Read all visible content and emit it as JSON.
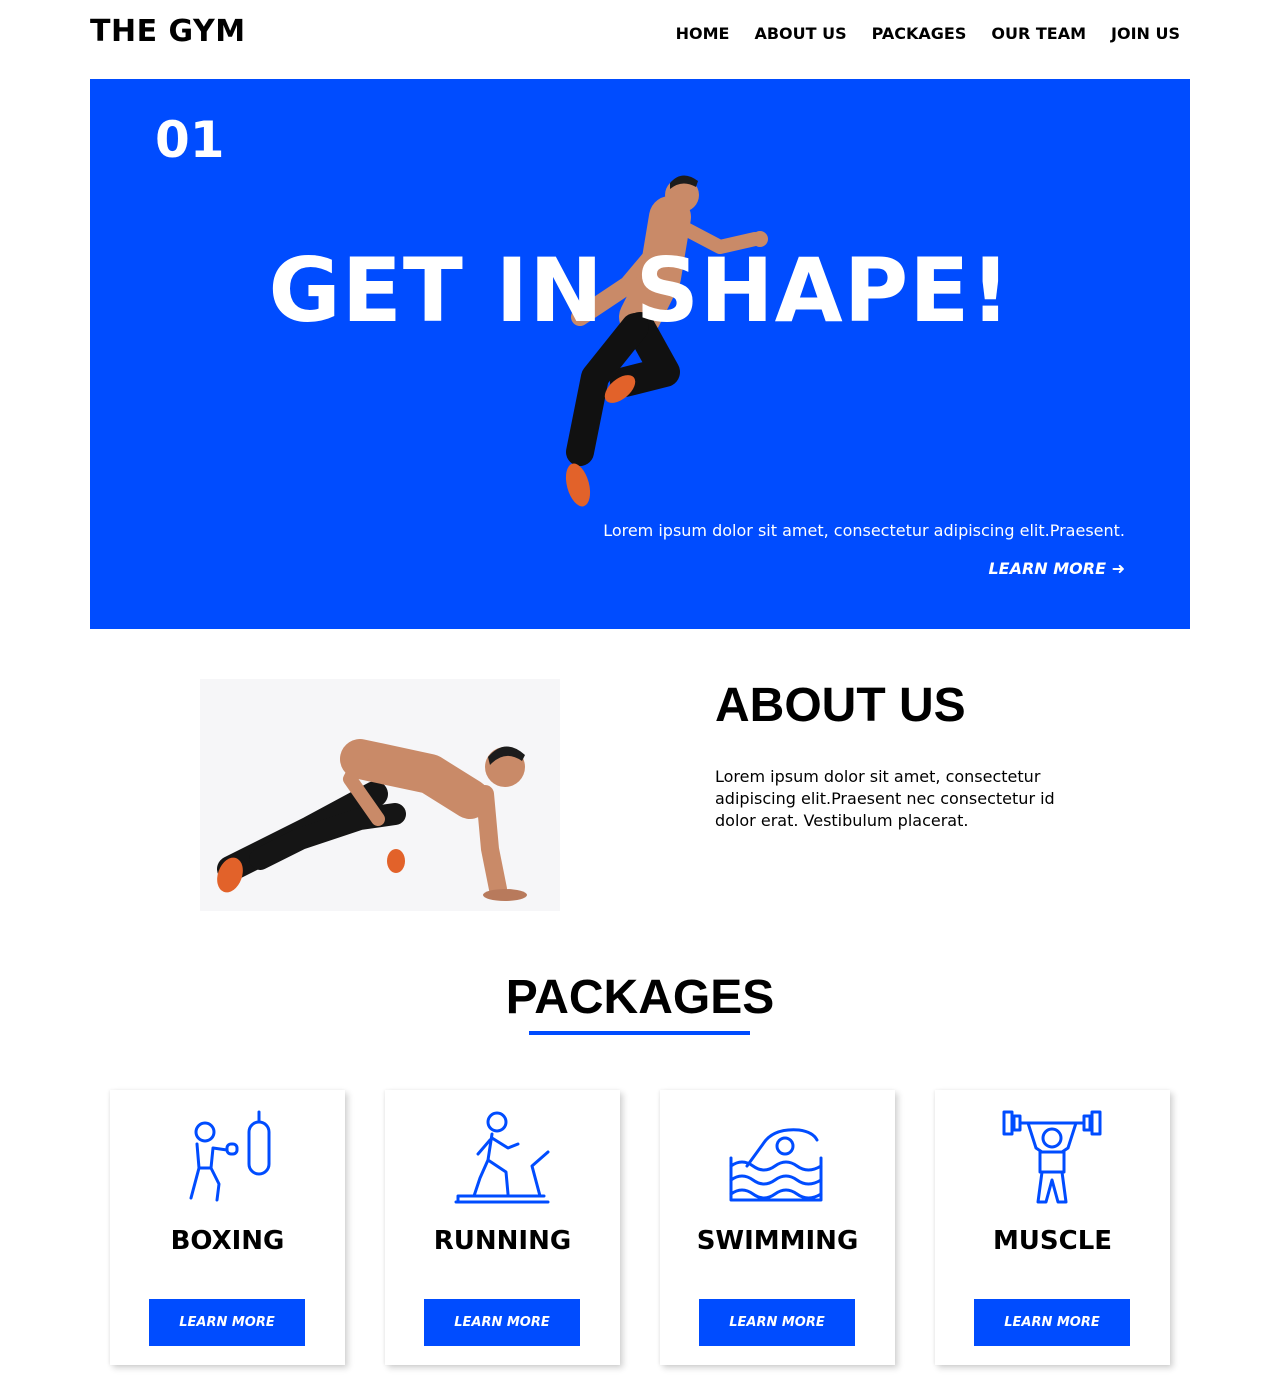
{
  "header": {
    "logo": "THE GYM",
    "nav": [
      "HOME",
      "ABOUT US",
      "PACKAGES",
      "OUR TEAM",
      "JOIN US"
    ]
  },
  "hero": {
    "number": "01",
    "title": "GET IN SHAPE!",
    "text": "Lorem ipsum dolor sit amet, consectetur adipiscing elit.Praesent.",
    "link": "LEARN MORE ➜"
  },
  "about": {
    "title": "ABOUT US",
    "text": "Lorem ipsum dolor sit amet, consectetur adipiscing elit.Praesent nec consectetur id dolor erat. Vestibulum placerat."
  },
  "packages": {
    "title": "PACKAGES",
    "items": [
      {
        "title": "BOXING",
        "button": "LEARN MORE",
        "icon": "boxing-icon"
      },
      {
        "title": "RUNNING",
        "button": "LEARN MORE",
        "icon": "running-icon"
      },
      {
        "title": "SWIMMING",
        "button": "LEARN MORE",
        "icon": "swimming-icon"
      },
      {
        "title": "MUSCLE",
        "button": "LEARN MORE",
        "icon": "weightlifting-icon"
      }
    ]
  },
  "colors": {
    "accent": "#004cff",
    "text": "#000000",
    "background": "#ffffff"
  }
}
